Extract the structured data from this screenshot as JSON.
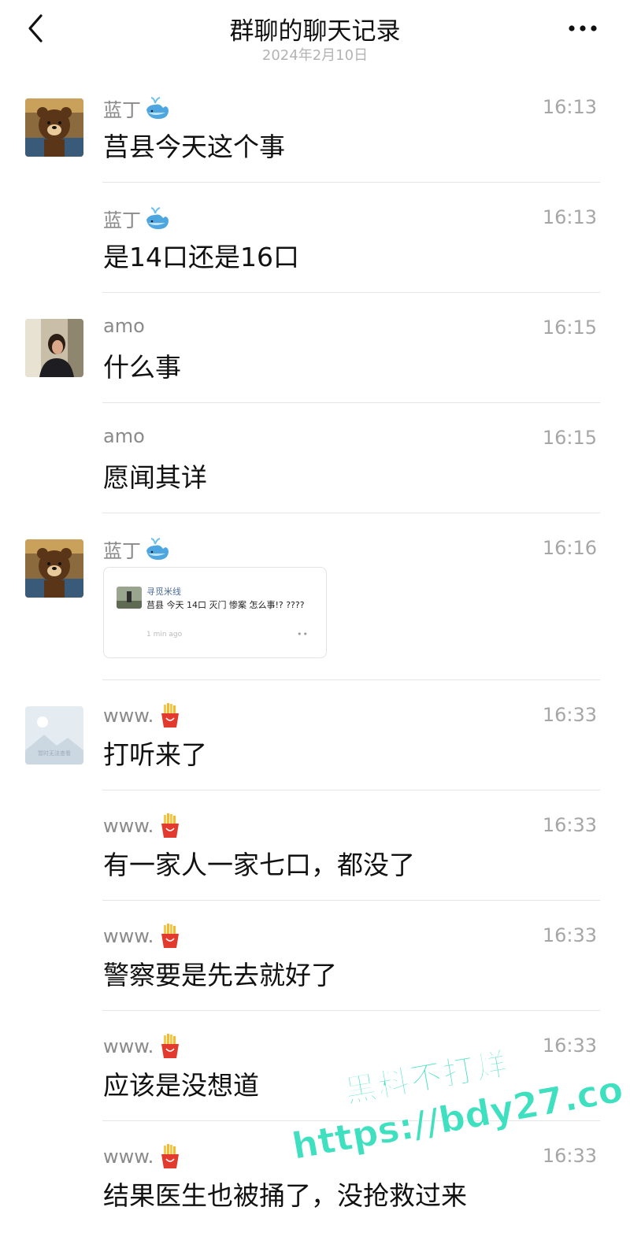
{
  "header": {
    "title": "群聊的聊天记录",
    "date": "2024年2月10日"
  },
  "messages": [
    {
      "sender": "蓝丁",
      "sender_emoji": "whale-emoji",
      "time": "16:13",
      "text": "莒县今天这个事",
      "avatar": "bear-avatar"
    },
    {
      "sender": "蓝丁",
      "sender_emoji": "whale-emoji",
      "time": "16:13",
      "text": "是14口还是16口"
    },
    {
      "sender": "amo",
      "time": "16:15",
      "text": "什么事",
      "avatar": "woman-avatar"
    },
    {
      "sender": "amo",
      "time": "16:15",
      "text": "愿闻其详"
    },
    {
      "sender": "蓝丁",
      "sender_emoji": "whale-emoji",
      "time": "16:16",
      "avatar": "bear-avatar",
      "card": {
        "author": "寻觅米线",
        "body": "莒县 今天 14口 灭门 惨案 怎么事!? ????",
        "meta": "1 min ago",
        "dots": "••"
      }
    },
    {
      "sender": "www.",
      "sender_emoji": "fries-emoji",
      "time": "16:33",
      "text": "打听来了",
      "avatar": "placeholder-avatar",
      "avatar_caption": "暂时无法查看"
    },
    {
      "sender": "www.",
      "sender_emoji": "fries-emoji",
      "time": "16:33",
      "text": "有一家人一家七口，都没了"
    },
    {
      "sender": "www.",
      "sender_emoji": "fries-emoji",
      "time": "16:33",
      "text": "警察要是先去就好了"
    },
    {
      "sender": "www.",
      "sender_emoji": "fries-emoji",
      "time": "16:33",
      "text": "应该是没想道"
    },
    {
      "sender": "www.",
      "sender_emoji": "fries-emoji",
      "time": "16:33",
      "text": "结果医生也被捅了，没抢救过来"
    }
  ],
  "watermark": {
    "line1": "黑料不打烊",
    "line2": "https://bdy27.co"
  },
  "colors": {
    "watermark": "#3fe0c0",
    "divider": "#e5e5e5",
    "secondary_text": "#8a8a8a"
  }
}
